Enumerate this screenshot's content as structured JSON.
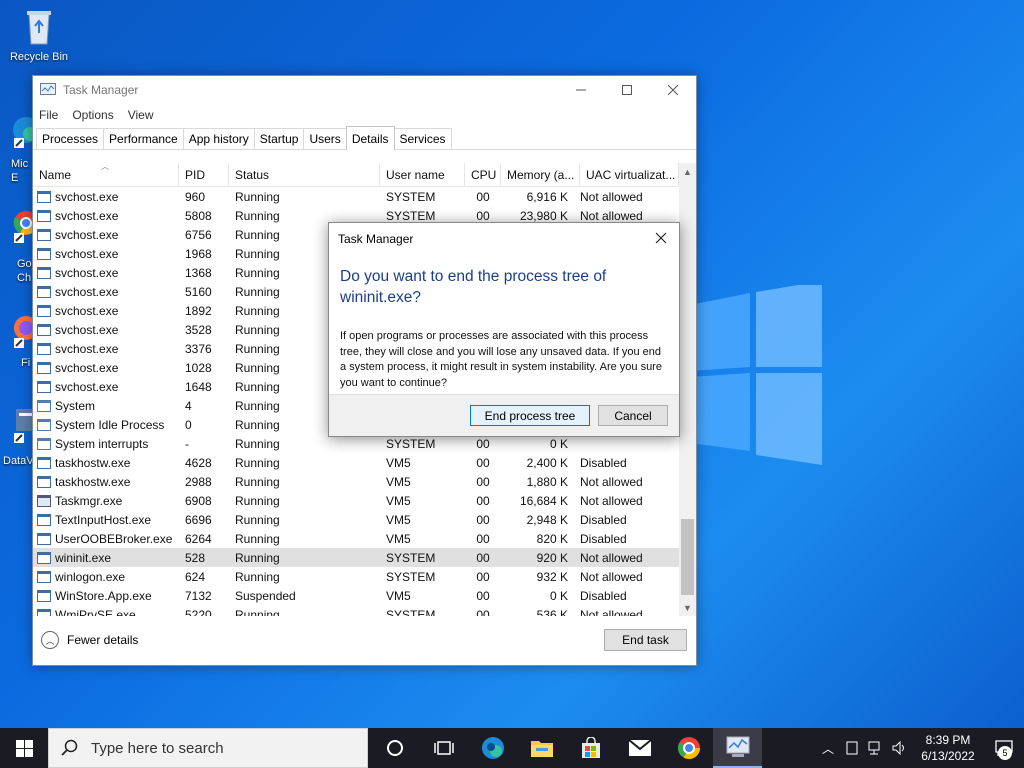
{
  "colors": {
    "dialog_heading": "#1c3d8f",
    "primary_border": "#0078d7",
    "taskbar": "#1b1b24"
  },
  "desktop": {
    "icons": [
      {
        "label": "Recycle Bin",
        "icon": "recycle-bin-icon"
      },
      {
        "label": "Mic\nE",
        "icon": "edge-shortcut-icon"
      },
      {
        "label": "Go\nCh",
        "icon": "chrome-shortcut-icon"
      },
      {
        "label": "Fi",
        "icon": "firefox-shortcut-icon"
      },
      {
        "label": "DataV",
        "icon": "dataview-shortcut-icon"
      }
    ]
  },
  "window": {
    "title": "Task Manager",
    "menu": [
      "File",
      "Options",
      "View"
    ],
    "tabs": [
      "Processes",
      "Performance",
      "App history",
      "Startup",
      "Users",
      "Details",
      "Services"
    ],
    "active_tab": "Details",
    "columns": [
      "Name",
      "PID",
      "Status",
      "User name",
      "CPU",
      "Memory (a...",
      "UAC virtualizat..."
    ],
    "rows": [
      {
        "name": "svchost.exe",
        "pid": "960",
        "status": "Running",
        "user": "SYSTEM",
        "cpu": "00",
        "mem": "6,916 K",
        "uac": "Not allowed"
      },
      {
        "name": "svchost.exe",
        "pid": "5808",
        "status": "Running",
        "user": "SYSTEM",
        "cpu": "00",
        "mem": "23,980 K",
        "uac": "Not allowed"
      },
      {
        "name": "svchost.exe",
        "pid": "6756",
        "status": "Running",
        "user": "",
        "cpu": "",
        "mem": "",
        "uac": ""
      },
      {
        "name": "svchost.exe",
        "pid": "1968",
        "status": "Running",
        "user": "",
        "cpu": "",
        "mem": "",
        "uac": ""
      },
      {
        "name": "svchost.exe",
        "pid": "1368",
        "status": "Running",
        "user": "",
        "cpu": "",
        "mem": "",
        "uac": ""
      },
      {
        "name": "svchost.exe",
        "pid": "5160",
        "status": "Running",
        "user": "",
        "cpu": "",
        "mem": "",
        "uac": ""
      },
      {
        "name": "svchost.exe",
        "pid": "1892",
        "status": "Running",
        "user": "",
        "cpu": "",
        "mem": "",
        "uac": ""
      },
      {
        "name": "svchost.exe",
        "pid": "3528",
        "status": "Running",
        "user": "",
        "cpu": "",
        "mem": "",
        "uac": ""
      },
      {
        "name": "svchost.exe",
        "pid": "3376",
        "status": "Running",
        "user": "",
        "cpu": "",
        "mem": "",
        "uac": ""
      },
      {
        "name": "svchost.exe",
        "pid": "1028",
        "status": "Running",
        "user": "",
        "cpu": "",
        "mem": "",
        "uac": ""
      },
      {
        "name": "svchost.exe",
        "pid": "1648",
        "status": "Running",
        "user": "",
        "cpu": "",
        "mem": "",
        "uac": ""
      },
      {
        "name": "System",
        "pid": "4",
        "status": "Running",
        "user": "",
        "cpu": "",
        "mem": "",
        "uac": ""
      },
      {
        "name": "System Idle Process",
        "pid": "0",
        "status": "Running",
        "user": "",
        "cpu": "",
        "mem": "",
        "uac": ""
      },
      {
        "name": "System interrupts",
        "pid": "-",
        "status": "Running",
        "user": "SYSTEM",
        "cpu": "00",
        "mem": "0 K",
        "uac": ""
      },
      {
        "name": "taskhostw.exe",
        "pid": "4628",
        "status": "Running",
        "user": "VM5",
        "cpu": "00",
        "mem": "2,400 K",
        "uac": "Disabled"
      },
      {
        "name": "taskhostw.exe",
        "pid": "2988",
        "status": "Running",
        "user": "VM5",
        "cpu": "00",
        "mem": "1,880 K",
        "uac": "Not allowed"
      },
      {
        "name": "Taskmgr.exe",
        "pid": "6908",
        "status": "Running",
        "user": "VM5",
        "cpu": "00",
        "mem": "16,684 K",
        "uac": "Not allowed"
      },
      {
        "name": "TextInputHost.exe",
        "pid": "6696",
        "status": "Running",
        "user": "VM5",
        "cpu": "00",
        "mem": "2,948 K",
        "uac": "Disabled"
      },
      {
        "name": "UserOOBEBroker.exe",
        "pid": "6264",
        "status": "Running",
        "user": "VM5",
        "cpu": "00",
        "mem": "820 K",
        "uac": "Disabled"
      },
      {
        "name": "wininit.exe",
        "pid": "528",
        "status": "Running",
        "user": "SYSTEM",
        "cpu": "00",
        "mem": "920 K",
        "uac": "Not allowed"
      },
      {
        "name": "winlogon.exe",
        "pid": "624",
        "status": "Running",
        "user": "SYSTEM",
        "cpu": "00",
        "mem": "932 K",
        "uac": "Not allowed"
      },
      {
        "name": "WinStore.App.exe",
        "pid": "7132",
        "status": "Suspended",
        "user": "VM5",
        "cpu": "00",
        "mem": "0 K",
        "uac": "Disabled"
      },
      {
        "name": "WmiPrvSE.exe",
        "pid": "5220",
        "status": "Running",
        "user": "SYSTEM",
        "cpu": "00",
        "mem": "536 K",
        "uac": "Not allowed"
      }
    ],
    "selected_process": "wininit.exe",
    "fewer_details": "Fewer details",
    "end_task": "End task"
  },
  "dialog": {
    "title": "Task Manager",
    "heading": "Do you want to end the process tree of wininit.exe?",
    "body": "If open programs or processes are associated with this process tree, they will close and you will lose any unsaved data. If you end a system process, it might result in system instability. Are you sure you want to continue?",
    "primary_button": "End process tree",
    "cancel_button": "Cancel"
  },
  "taskbar": {
    "search_placeholder": "Type here to search",
    "pinned": [
      "task-view-icon",
      "edge-icon",
      "file-explorer-icon",
      "store-icon",
      "mail-icon",
      "chrome-icon",
      "task-manager-icon"
    ],
    "time": "8:39 PM",
    "date": "6/13/2022",
    "notification_count": "5"
  }
}
